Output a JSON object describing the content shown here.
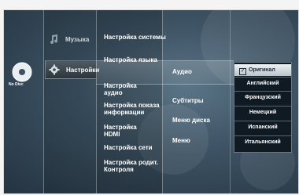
{
  "categories": [
    {
      "label": "Музыка",
      "icon": "music-icon"
    },
    {
      "label": "Настройки",
      "icon": "gear-icon"
    }
  ],
  "disc_status": "No Disc",
  "settings_menu": [
    "Настройка системы",
    "Настройка языка",
    "Настройка аудио",
    "Настройка показа информации",
    "Настройка HDMI",
    "Настройка сети",
    "Настройка родит. Контроля"
  ],
  "language_options": [
    "Аудио",
    "Субтитры",
    "Меню диска",
    "Меню"
  ],
  "audio_dropdown": {
    "selected": "Оригинал",
    "options": [
      "Оригинал",
      "Английский",
      "Французский",
      "Немецкий",
      "Испанский",
      "Итальянский"
    ]
  }
}
